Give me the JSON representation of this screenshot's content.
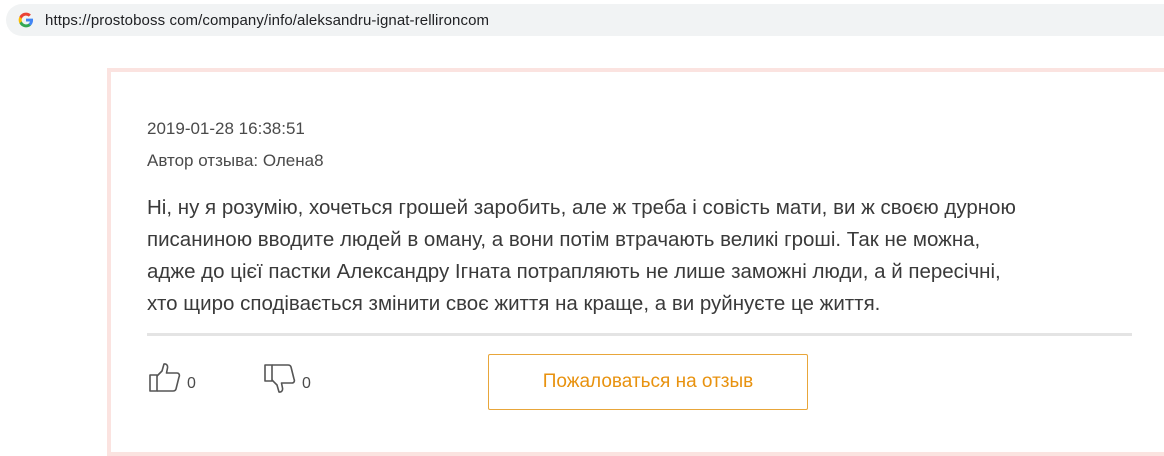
{
  "browser": {
    "url": "https://prostoboss com/company/info/aleksandru-ignat-rellironcom",
    "favicon_icon": "google-g-icon"
  },
  "review": {
    "date": "2019-01-28 16:38:51",
    "author_line": "Автор отзыва: Олена8",
    "text_lines": [
      "Ні, ну я розумію, хочеться грошей заробить, але ж треба і совість мати, ви ж своєю дурною",
      "писаниною вводите людей в оману, а вони потім втрачають великі гроші. Так не можна,",
      "адже до цієї пастки Александру Ігната потрапляють не лише заможні люди, а й пересічні,",
      "хто щиро сподівається змінити своє життя на краще, а ви руйнуєте це життя."
    ],
    "likes": "0",
    "dislikes": "0",
    "complain_label": "Пожаловаться на отзыв"
  },
  "colors": {
    "card_border": "#fbe3e0",
    "accent": "#e8920f",
    "button_border": "#e8a63a"
  }
}
